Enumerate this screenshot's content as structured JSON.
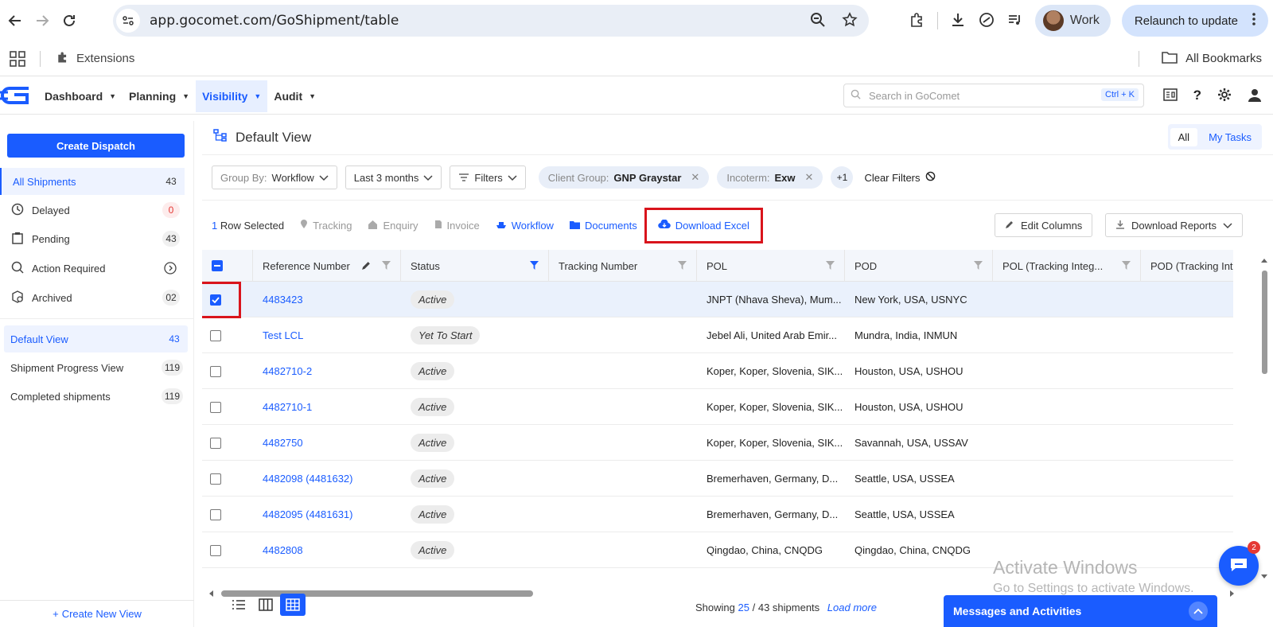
{
  "browser": {
    "url": "app.gocomet.com/GoShipment/table",
    "profile_label": "Work",
    "relaunch_label": "Relaunch to update",
    "extensions_label": "Extensions",
    "bookmarks_label": "All Bookmarks"
  },
  "header": {
    "nav": [
      {
        "label": "Dashboard"
      },
      {
        "label": "Planning"
      },
      {
        "label": "Visibility"
      },
      {
        "label": "Audit"
      }
    ],
    "search_placeholder": "Search in GoComet",
    "search_shortcut": "Ctrl + K"
  },
  "sidebar": {
    "create_dispatch": "Create Dispatch",
    "items": [
      {
        "label": "All Shipments",
        "count": "43"
      },
      {
        "label": "Delayed",
        "count": "0"
      },
      {
        "label": "Pending",
        "count": "43"
      },
      {
        "label": "Action Required",
        "count": ""
      },
      {
        "label": "Archived",
        "count": "02"
      }
    ],
    "views": [
      {
        "label": "Default View",
        "count": "43"
      },
      {
        "label": "Shipment Progress View",
        "count": "119"
      },
      {
        "label": "Completed shipments",
        "count": "119"
      }
    ],
    "create_view": "Create New View"
  },
  "main": {
    "title": "Default View",
    "segment": {
      "all": "All",
      "tasks": "My Tasks"
    },
    "filters": {
      "group_by_key": "Group By:",
      "group_by_value": "Workflow",
      "date_range": "Last 3 months",
      "filters_label": "Filters",
      "chips": [
        {
          "key": "Client Group:",
          "value": "GNP Graystar"
        },
        {
          "key": "Incoterm:",
          "value": "Exw"
        }
      ],
      "more": "+1",
      "clear": "Clear Filters"
    },
    "actions": {
      "row_count": "1",
      "row_selected": "Row Selected",
      "tracking": "Tracking",
      "enquiry": "Enquiry",
      "invoice": "Invoice",
      "workflow": "Workflow",
      "documents": "Documents",
      "download_excel": "Download Excel",
      "edit_columns": "Edit Columns",
      "download_reports": "Download Reports"
    },
    "columns": [
      "Reference Number",
      "Status",
      "Tracking Number",
      "POL",
      "POD",
      "POL (Tracking Integ...",
      "POD (Tracking Inte"
    ],
    "rows": [
      {
        "ref": "4483423",
        "status": "Active",
        "tracking": "",
        "pol": "JNPT (Nhava Sheva), Mum...",
        "pod": "New York, USA, USNYC",
        "selected": true
      },
      {
        "ref": "Test LCL",
        "status": "Yet To Start",
        "tracking": "",
        "pol": "Jebel Ali, United Arab Emir...",
        "pod": "Mundra, India, INMUN",
        "selected": false
      },
      {
        "ref": "4482710-2",
        "status": "Active",
        "tracking": "",
        "pol": "Koper, Koper, Slovenia, SIK...",
        "pod": "Houston, USA, USHOU",
        "selected": false
      },
      {
        "ref": "4482710-1",
        "status": "Active",
        "tracking": "",
        "pol": "Koper, Koper, Slovenia, SIK...",
        "pod": "Houston, USA, USHOU",
        "selected": false
      },
      {
        "ref": "4482750",
        "status": "Active",
        "tracking": "",
        "pol": "Koper, Koper, Slovenia, SIK...",
        "pod": "Savannah, USA, USSAV",
        "selected": false
      },
      {
        "ref": "4482098 (4481632)",
        "status": "Active",
        "tracking": "",
        "pol": "Bremerhaven, Germany, D...",
        "pod": "Seattle, USA, USSEA",
        "selected": false
      },
      {
        "ref": "4482095 (4481631)",
        "status": "Active",
        "tracking": "",
        "pol": "Bremerhaven, Germany, D...",
        "pod": "Seattle, USA, USSEA",
        "selected": false
      },
      {
        "ref": "4482808",
        "status": "Active",
        "tracking": "",
        "pol": "Qingdao, China, CNQDG",
        "pod": "Qingdao, China, CNQDG",
        "selected": false
      }
    ],
    "footer": {
      "showing": "Showing",
      "shown": "25",
      "sep": "/",
      "total": "43 shipments",
      "load_more": "Load more",
      "messages": "Messages and Activities"
    }
  },
  "watermark": {
    "line1": "Activate Windows",
    "line2": "Go to Settings to activate Windows."
  },
  "chat_count": "2",
  "colors": {
    "brand": "#1a5cff",
    "highlight": "#d9141c",
    "alert": "#e53935"
  }
}
